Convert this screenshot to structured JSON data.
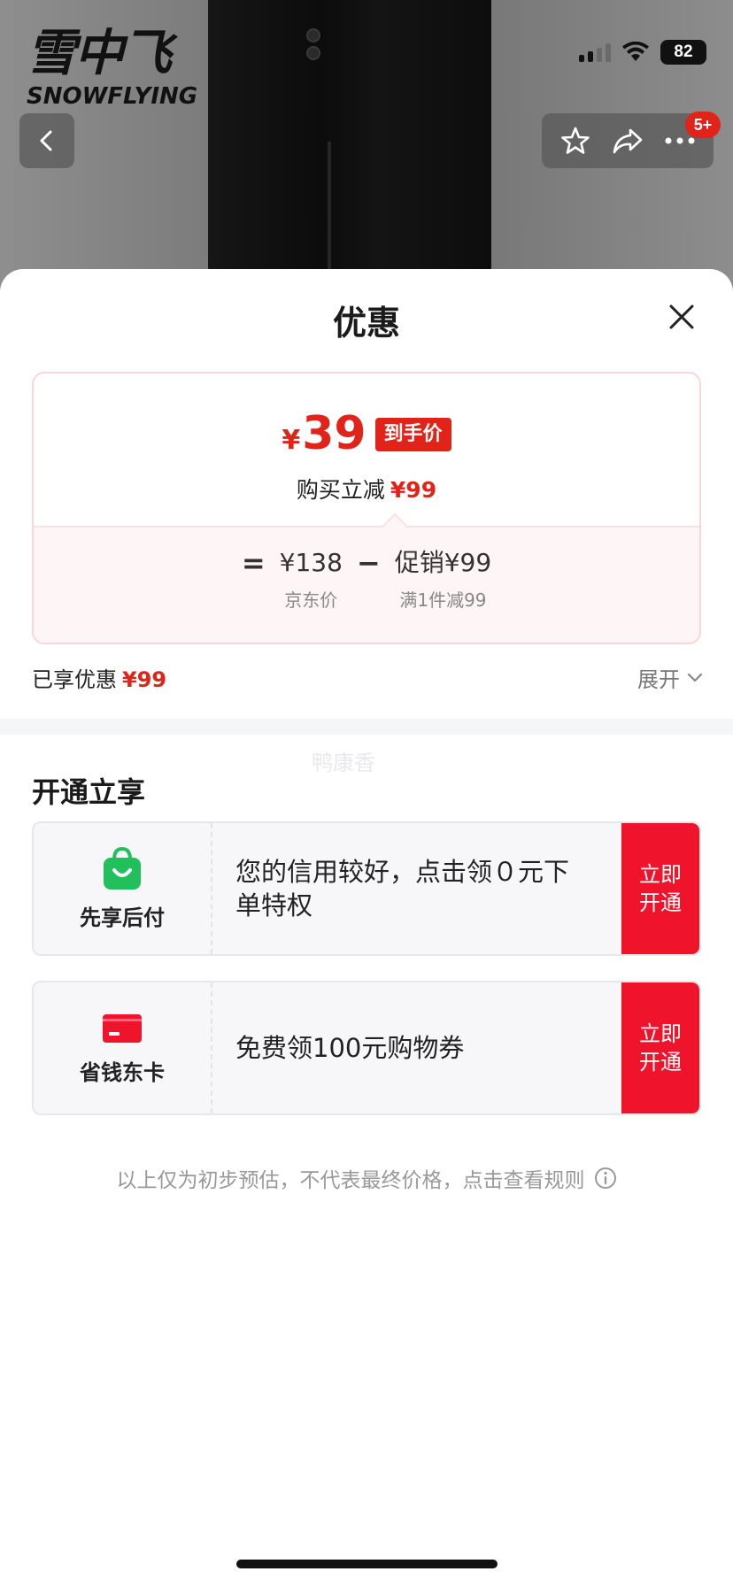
{
  "brand": {
    "name_cn": "雪中飞",
    "name_en": "SNOWFLYING"
  },
  "status_bar": {
    "battery": "82"
  },
  "nav": {
    "cart_badge": "5+"
  },
  "sheet": {
    "title": "优惠",
    "price": {
      "currency": "¥",
      "final_value": "39",
      "final_tag": "到手价",
      "reduce_label": "购买立减",
      "reduce_value": "¥99",
      "formula": {
        "equals": "=",
        "minus": "−",
        "base_value": "¥138",
        "base_label": "京东价",
        "promo_value": "促销¥99",
        "promo_label": "满1件减99"
      }
    },
    "enjoyed_label": "已享优惠",
    "enjoyed_value": "¥99",
    "expand_label": "展开",
    "watermark": "鸭康香",
    "section_title": "开通立享",
    "services": [
      {
        "name": "先享后付",
        "icon": "shopping-bag-icon",
        "desc": "您的信用较好，点击领０元下单特权",
        "button_line1": "立即",
        "button_line2": "开通"
      },
      {
        "name": "省钱东卡",
        "icon": "card-icon",
        "desc": "免费领100元购物券",
        "button_line1": "立即",
        "button_line2": "开通"
      }
    ],
    "disclaimer": "以上仅为初步预估，不代表最终价格，点击查看规则"
  },
  "colors": {
    "accent": "#e2231a",
    "button": "#f0132c",
    "bag_green": "#21c05c"
  }
}
